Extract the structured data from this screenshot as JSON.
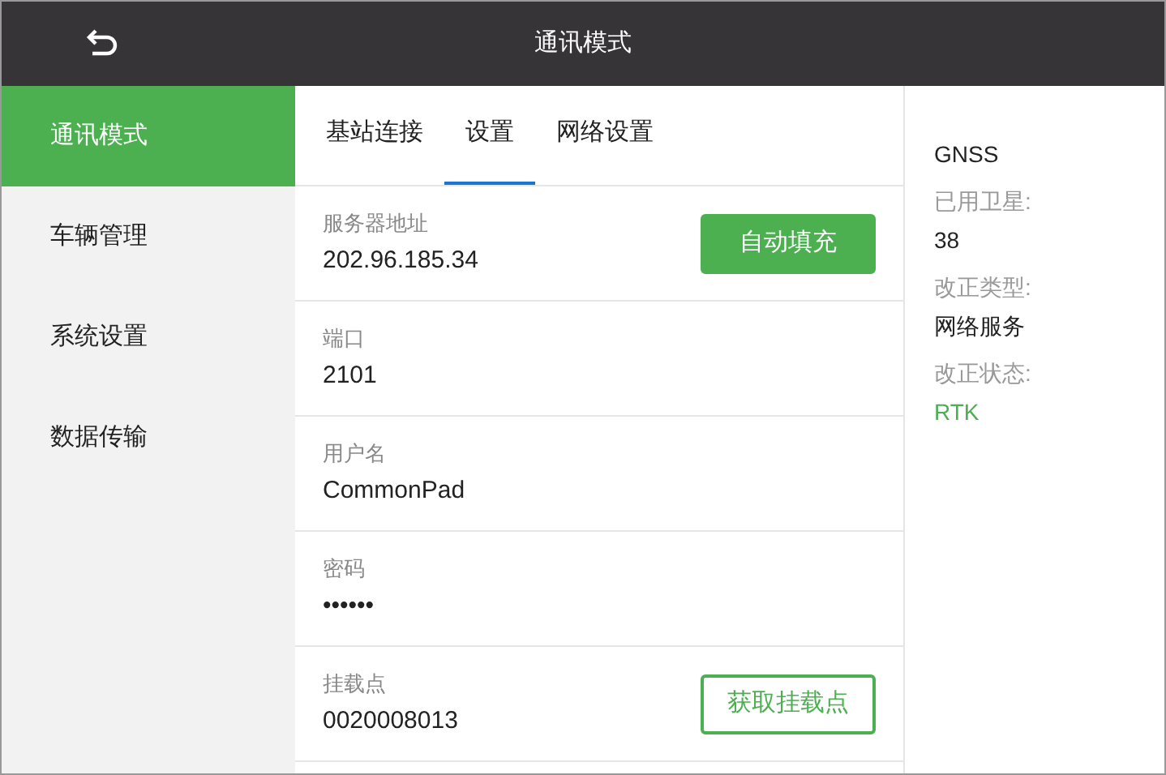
{
  "header": {
    "title": "通讯模式"
  },
  "sidebar": {
    "items": [
      {
        "label": "通讯模式",
        "selected": true
      },
      {
        "label": "车辆管理",
        "selected": false
      },
      {
        "label": "系统设置",
        "selected": false
      },
      {
        "label": "数据传输",
        "selected": false
      }
    ]
  },
  "tabs": [
    {
      "label": "基站连接",
      "selected": false
    },
    {
      "label": "设置",
      "selected": true
    },
    {
      "label": "网络设置",
      "selected": false
    }
  ],
  "fields": [
    {
      "label": "服务器地址",
      "value": "202.96.185.34",
      "button": {
        "label": "自动填充",
        "kind": "filled"
      }
    },
    {
      "label": "端口",
      "value": "2101"
    },
    {
      "label": "用户名",
      "value": "CommonPad"
    },
    {
      "label": "密码",
      "value": "••••••"
    },
    {
      "label": "挂载点",
      "value": "0020008013",
      "button": {
        "label": "获取挂载点",
        "kind": "outlined"
      }
    }
  ],
  "status": {
    "title": "GNSS",
    "items": [
      {
        "label": "已用卫星:",
        "value": "38",
        "color": "#222222"
      },
      {
        "label": "改正类型:",
        "value": "网络服务",
        "color": "#222222"
      },
      {
        "label": "改正状态:",
        "value": "RTK",
        "color": "#4caf50"
      }
    ]
  }
}
